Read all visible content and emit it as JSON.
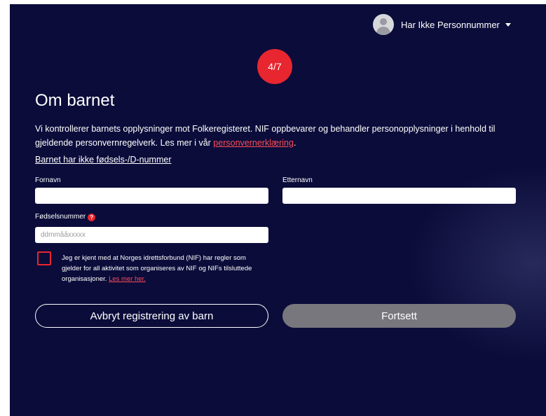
{
  "header": {
    "user_name": "Har Ikke Personnummer",
    "avatar_icon": "user-avatar-icon",
    "menu_icon": "caret-down-icon"
  },
  "step": {
    "label": "4/7"
  },
  "title": "Om barnet",
  "intro": {
    "text": "Vi kontrollerer barnets opplysninger mot Folkeregisteret. NIF oppbevarer og behandler personopplysninger i henhold til gjeldende personvernregelverk. Les mer i vår ",
    "link": "personvernerklæring",
    "suffix": "."
  },
  "no_id_link": "Barnet har ikke fødsels-/D-nummer",
  "form": {
    "first_name": {
      "label": "Fornavn",
      "value": "",
      "placeholder": ""
    },
    "last_name": {
      "label": "Etternavn",
      "value": "",
      "placeholder": ""
    },
    "birth_number": {
      "label": "Fødselsnummer",
      "value": "",
      "placeholder": "ddmmååxxxxx",
      "help_icon": "question-mark-icon",
      "help_glyph": "?"
    }
  },
  "consent": {
    "checked": false,
    "text": "Jeg er kjent med at Norges idrettsforbund (NIF) har regler som gjelder for all aktivitet som organiseres av NIF og NIFs tilsluttede organisasjoner. ",
    "link": "Les mer her."
  },
  "buttons": {
    "cancel": "Avbryt registrering av barn",
    "continue": "Fortsett"
  },
  "colors": {
    "background": "#0b0c3a",
    "accent": "#e8262f",
    "link": "#ff4d57",
    "disabled_button": "#77777d"
  }
}
